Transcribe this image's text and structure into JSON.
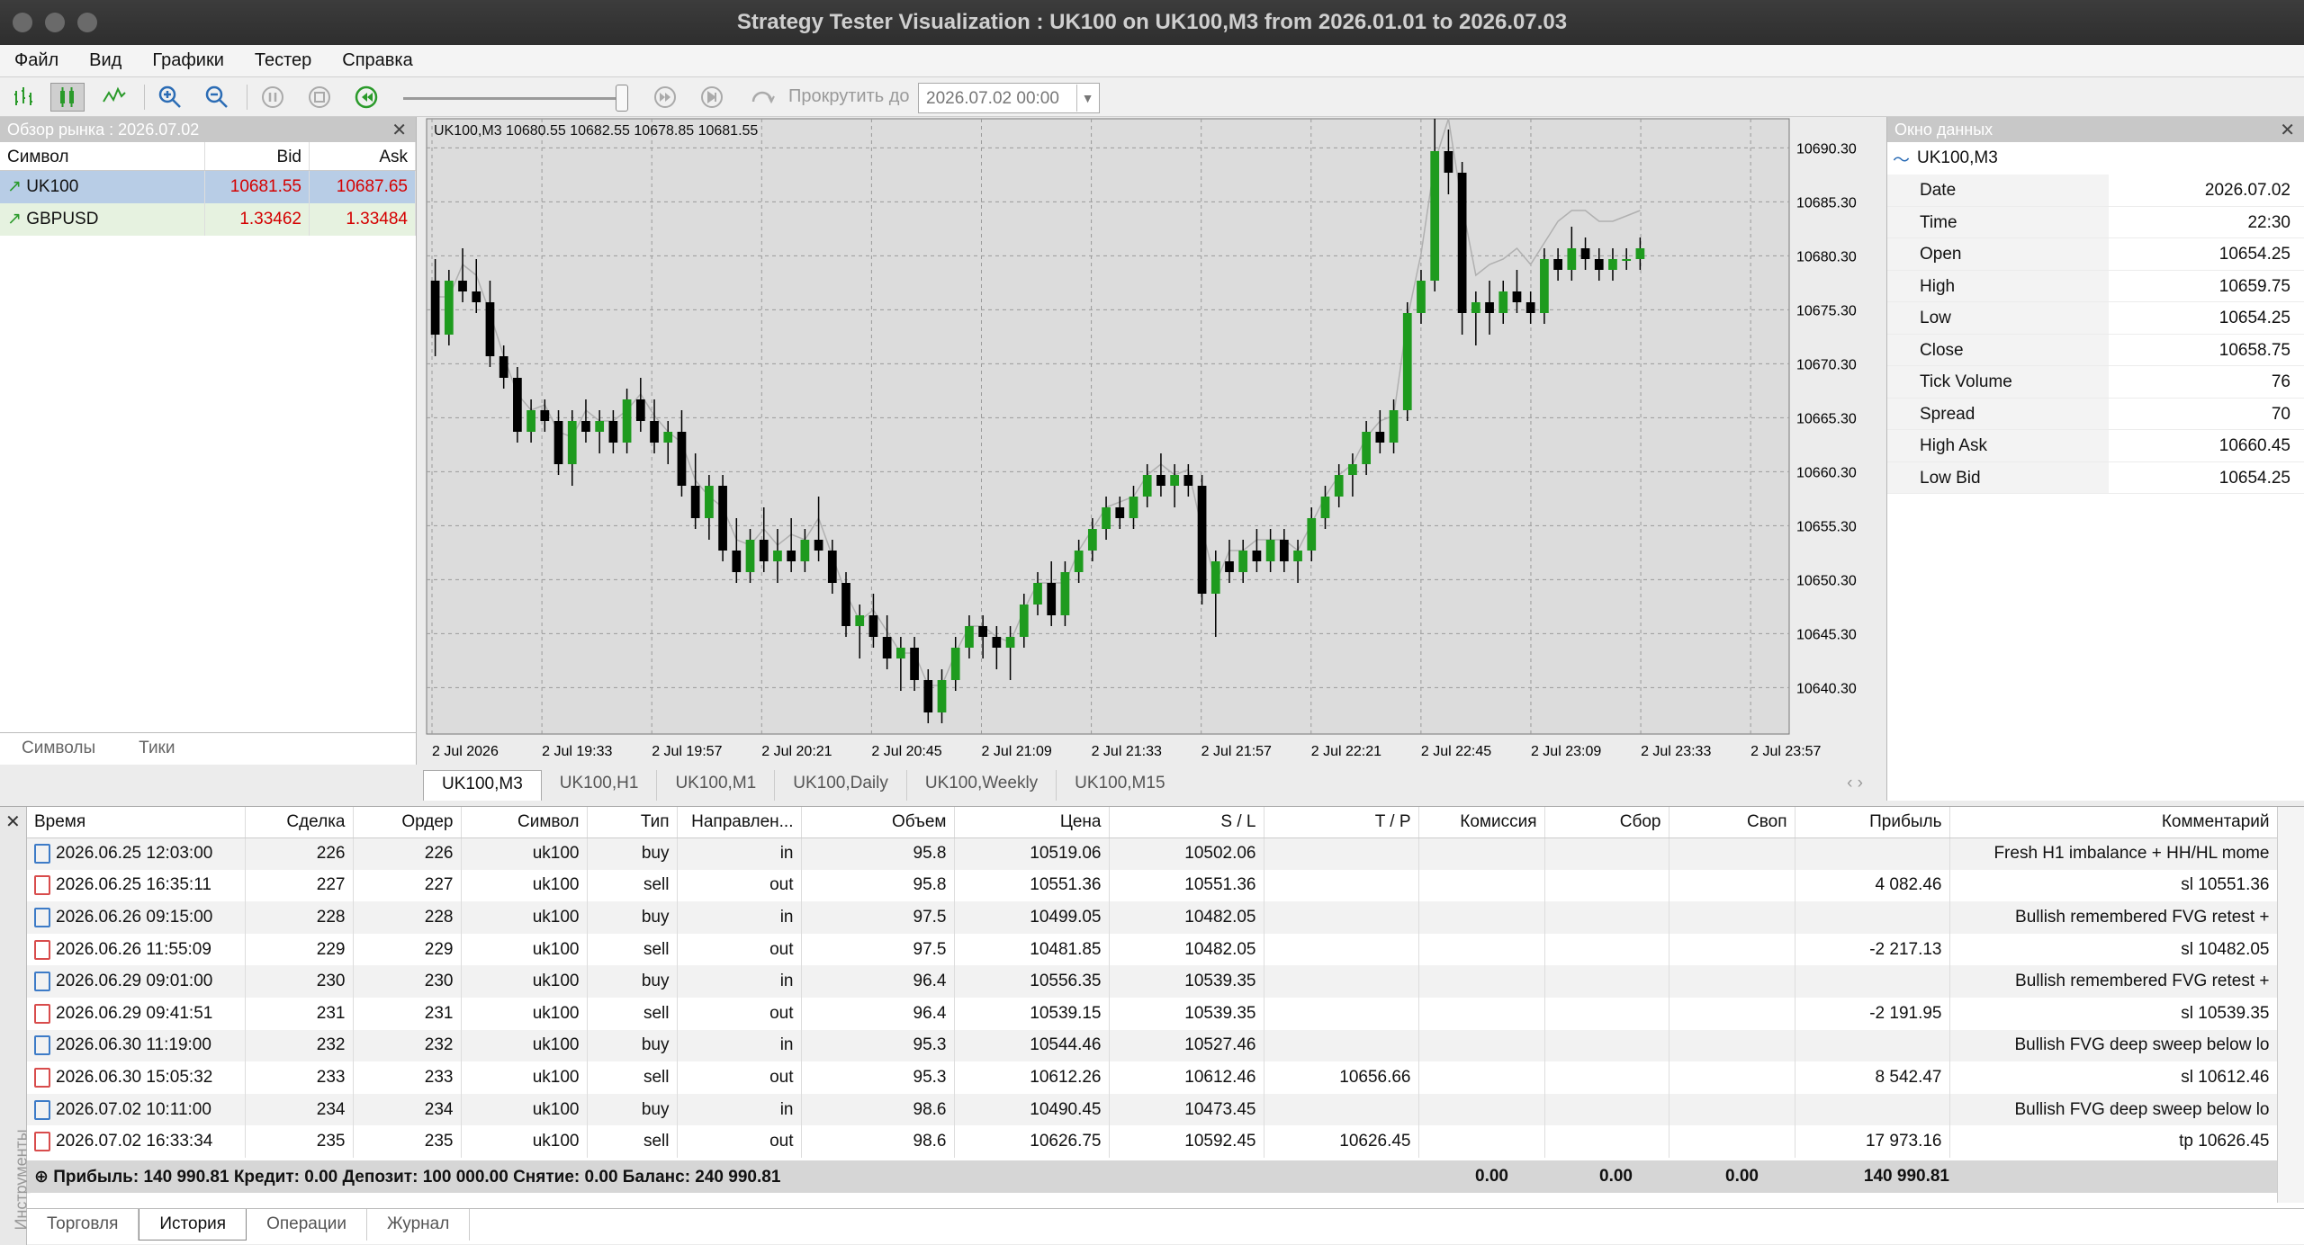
{
  "window": {
    "title": "Strategy Tester Visualization : UK100 on UK100,M3 from 2026.01.01 to 2026.07.03"
  },
  "menu": [
    "Файл",
    "Вид",
    "Графики",
    "Тестер",
    "Справка"
  ],
  "toolbar": {
    "scroll_label": "Прокрутить до",
    "scroll_date": "2026.07.02 00:00"
  },
  "market_watch": {
    "title": "Обзор рынка : 2026.07.02",
    "columns": [
      "Символ",
      "Bid",
      "Ask"
    ],
    "rows": [
      {
        "symbol": "UK100",
        "bid": "10681.55",
        "ask": "10687.65"
      },
      {
        "symbol": "GBPUSD",
        "bid": "1.33462",
        "ask": "1.33484"
      }
    ],
    "tabs": [
      "Символы",
      "Тики"
    ]
  },
  "chart": {
    "header": "UK100,M3  10680.55 10682.55 10678.85 10681.55",
    "y_ticks": [
      "10690.30",
      "10685.30",
      "10680.30",
      "10675.30",
      "10670.30",
      "10665.30",
      "10660.30",
      "10655.30",
      "10650.30",
      "10645.30",
      "10640.30"
    ],
    "x_ticks": [
      "2 Jul 2026",
      "2 Jul 19:33",
      "2 Jul 19:57",
      "2 Jul 20:21",
      "2 Jul 20:45",
      "2 Jul 21:09",
      "2 Jul 21:33",
      "2 Jul 21:57",
      "2 Jul 22:21",
      "2 Jul 22:45",
      "2 Jul 23:09",
      "2 Jul 23:33",
      "2 Jul 23:57"
    ],
    "tabs": [
      "UK100,M3",
      "UK100,H1",
      "UK100,M1",
      "UK100,Daily",
      "UK100,Weekly",
      "UK100,M15"
    ],
    "colors": {
      "bull": "#1e9b1e",
      "bear": "#000000",
      "bg": "#dcdcdc",
      "line": "#b0b0b0"
    },
    "candles": [
      [
        10678,
        10680,
        10671,
        10673
      ],
      [
        10673,
        10679,
        10672,
        10678
      ],
      [
        10678,
        10681,
        10676,
        10677
      ],
      [
        10677,
        10680,
        10675,
        10676
      ],
      [
        10676,
        10678,
        10670,
        10671
      ],
      [
        10671,
        10672,
        10668,
        10669
      ],
      [
        10669,
        10670,
        10663,
        10664
      ],
      [
        10664,
        10667,
        10663,
        10666
      ],
      [
        10666,
        10667,
        10664,
        10665
      ],
      [
        10665,
        10666,
        10660,
        10661
      ],
      [
        10661,
        10666,
        10659,
        10665
      ],
      [
        10665,
        10667,
        10663,
        10664
      ],
      [
        10664,
        10666,
        10662,
        10665
      ],
      [
        10665,
        10666,
        10662,
        10663
      ],
      [
        10663,
        10668,
        10662,
        10667
      ],
      [
        10667,
        10669,
        10664,
        10665
      ],
      [
        10665,
        10667,
        10662,
        10663
      ],
      [
        10663,
        10665,
        10661,
        10664
      ],
      [
        10664,
        10666,
        10658,
        10659
      ],
      [
        10659,
        10662,
        10655,
        10656
      ],
      [
        10656,
        10660,
        10654,
        10659
      ],
      [
        10659,
        10660,
        10652,
        10653
      ],
      [
        10653,
        10656,
        10650,
        10651
      ],
      [
        10651,
        10655,
        10650,
        10654
      ],
      [
        10654,
        10657,
        10651,
        10652
      ],
      [
        10652,
        10655,
        10650,
        10653
      ],
      [
        10653,
        10656,
        10651,
        10652
      ],
      [
        10652,
        10655,
        10651,
        10654
      ],
      [
        10654,
        10658,
        10652,
        10653
      ],
      [
        10653,
        10654,
        10649,
        10650
      ],
      [
        10650,
        10651,
        10645,
        10646
      ],
      [
        10646,
        10648,
        10643,
        10647
      ],
      [
        10647,
        10649,
        10644,
        10645
      ],
      [
        10645,
        10647,
        10642,
        10643
      ],
      [
        10643,
        10645,
        10640,
        10644
      ],
      [
        10644,
        10645,
        10640,
        10641
      ],
      [
        10641,
        10642,
        10637,
        10638
      ],
      [
        10638,
        10642,
        10637,
        10641
      ],
      [
        10641,
        10645,
        10640,
        10644
      ],
      [
        10644,
        10647,
        10643,
        10646
      ],
      [
        10646,
        10647,
        10643,
        10645
      ],
      [
        10645,
        10646,
        10642,
        10644
      ],
      [
        10644,
        10646,
        10641,
        10645
      ],
      [
        10645,
        10649,
        10644,
        10648
      ],
      [
        10648,
        10651,
        10647,
        10650
      ],
      [
        10650,
        10652,
        10646,
        10647
      ],
      [
        10647,
        10652,
        10646,
        10651
      ],
      [
        10651,
        10654,
        10650,
        10653
      ],
      [
        10653,
        10656,
        10652,
        10655
      ],
      [
        10655,
        10658,
        10654,
        10657
      ],
      [
        10657,
        10658,
        10655,
        10656
      ],
      [
        10656,
        10659,
        10655,
        10658
      ],
      [
        10658,
        10661,
        10657,
        10660
      ],
      [
        10660,
        10662,
        10658,
        10659
      ],
      [
        10659,
        10661,
        10657,
        10660
      ],
      [
        10660,
        10661,
        10658,
        10659
      ],
      [
        10659,
        10660,
        10648,
        10649
      ],
      [
        10649,
        10653,
        10645,
        10652
      ],
      [
        10652,
        10654,
        10650,
        10651
      ],
      [
        10651,
        10654,
        10650,
        10653
      ],
      [
        10653,
        10655,
        10651,
        10652
      ],
      [
        10652,
        10655,
        10651,
        10654
      ],
      [
        10654,
        10655,
        10651,
        10652
      ],
      [
        10652,
        10654,
        10650,
        10653
      ],
      [
        10653,
        10657,
        10652,
        10656
      ],
      [
        10656,
        10659,
        10655,
        10658
      ],
      [
        10658,
        10661,
        10657,
        10660
      ],
      [
        10660,
        10662,
        10658,
        10661
      ],
      [
        10661,
        10665,
        10660,
        10664
      ],
      [
        10664,
        10666,
        10662,
        10663
      ],
      [
        10663,
        10667,
        10662,
        10666
      ],
      [
        10666,
        10676,
        10665,
        10675
      ],
      [
        10675,
        10679,
        10674,
        10678
      ],
      [
        10678,
        10693,
        10677,
        10690
      ],
      [
        10690,
        10692,
        10686,
        10688
      ],
      [
        10688,
        10689,
        10673,
        10675
      ],
      [
        10675,
        10677,
        10672,
        10676
      ],
      [
        10676,
        10678,
        10673,
        10675
      ],
      [
        10675,
        10678,
        10674,
        10677
      ],
      [
        10677,
        10679,
        10675,
        10676
      ],
      [
        10676,
        10677,
        10674,
        10675
      ],
      [
        10675,
        10681,
        10674,
        10680
      ],
      [
        10680,
        10681,
        10678,
        10679
      ],
      [
        10679,
        10683,
        10678,
        10681
      ],
      [
        10681,
        10682,
        10679,
        10680
      ],
      [
        10680,
        10681,
        10678,
        10679
      ],
      [
        10679,
        10681,
        10678,
        10680
      ],
      [
        10680,
        10681,
        10679,
        10680
      ],
      [
        10680,
        10682,
        10679,
        10681
      ]
    ]
  },
  "data_window": {
    "title": "Окно данных",
    "symbol": "UK100,M3",
    "rows": [
      {
        "k": "Date",
        "v": "2026.07.02"
      },
      {
        "k": "Time",
        "v": "22:30"
      },
      {
        "k": "Open",
        "v": "10654.25"
      },
      {
        "k": "High",
        "v": "10659.75"
      },
      {
        "k": "Low",
        "v": "10654.25"
      },
      {
        "k": "Close",
        "v": "10658.75"
      },
      {
        "k": "Tick Volume",
        "v": "76"
      },
      {
        "k": "Spread",
        "v": "70"
      },
      {
        "k": "High Ask",
        "v": "10660.45"
      },
      {
        "k": "Low Bid",
        "v": "10654.25"
      }
    ]
  },
  "trades": {
    "columns": [
      "Время",
      "Сделка",
      "Ордер",
      "Символ",
      "Тип",
      "Направлен...",
      "Объем",
      "Цена",
      "S / L",
      "T / P",
      "Комиссия",
      "Сбор",
      "Своп",
      "Прибыль",
      "Комментарий"
    ],
    "rows": [
      [
        "2026.06.25 12:03:00",
        "226",
        "226",
        "uk100",
        "buy",
        "in",
        "95.8",
        "10519.06",
        "10502.06",
        "",
        "",
        "",
        "",
        "",
        "Fresh H1 imbalance + HH/HL mome"
      ],
      [
        "2026.06.25 16:35:11",
        "227",
        "227",
        "uk100",
        "sell",
        "out",
        "95.8",
        "10551.36",
        "10551.36",
        "",
        "",
        "",
        "",
        "4 082.46",
        "sl 10551.36"
      ],
      [
        "2026.06.26 09:15:00",
        "228",
        "228",
        "uk100",
        "buy",
        "in",
        "97.5",
        "10499.05",
        "10482.05",
        "",
        "",
        "",
        "",
        "",
        "Bullish remembered FVG retest +"
      ],
      [
        "2026.06.26 11:55:09",
        "229",
        "229",
        "uk100",
        "sell",
        "out",
        "97.5",
        "10481.85",
        "10482.05",
        "",
        "",
        "",
        "",
        "-2 217.13",
        "sl 10482.05"
      ],
      [
        "2026.06.29 09:01:00",
        "230",
        "230",
        "uk100",
        "buy",
        "in",
        "96.4",
        "10556.35",
        "10539.35",
        "",
        "",
        "",
        "",
        "",
        "Bullish remembered FVG retest +"
      ],
      [
        "2026.06.29 09:41:51",
        "231",
        "231",
        "uk100",
        "sell",
        "out",
        "96.4",
        "10539.15",
        "10539.35",
        "",
        "",
        "",
        "",
        "-2 191.95",
        "sl 10539.35"
      ],
      [
        "2026.06.30 11:19:00",
        "232",
        "232",
        "uk100",
        "buy",
        "in",
        "95.3",
        "10544.46",
        "10527.46",
        "",
        "",
        "",
        "",
        "",
        "Bullish FVG deep sweep below lo"
      ],
      [
        "2026.06.30 15:05:32",
        "233",
        "233",
        "uk100",
        "sell",
        "out",
        "95.3",
        "10612.26",
        "10612.46",
        "10656.66",
        "",
        "",
        "",
        "8 542.47",
        "sl 10612.46"
      ],
      [
        "2026.07.02 10:11:00",
        "234",
        "234",
        "uk100",
        "buy",
        "in",
        "98.6",
        "10490.45",
        "10473.45",
        "",
        "",
        "",
        "",
        "",
        "Bullish FVG deep sweep below lo"
      ],
      [
        "2026.07.02 16:33:34",
        "235",
        "235",
        "uk100",
        "sell",
        "out",
        "98.6",
        "10626.75",
        "10592.45",
        "10626.45",
        "",
        "",
        "",
        "17 973.16",
        "tp 10626.45"
      ]
    ],
    "summary": {
      "text": "Прибыль: 140 990.81  Кредит: 0.00  Депозит: 100 000.00  Снятие: 0.00  Баланс: 240 990.81",
      "commission": "0.00",
      "fee": "0.00",
      "swap": "0.00",
      "profit": "140 990.81"
    }
  },
  "sidebar_label": "Инструменты",
  "bottom_tabs": [
    "Торговля",
    "История",
    "Операции",
    "Журнал"
  ]
}
